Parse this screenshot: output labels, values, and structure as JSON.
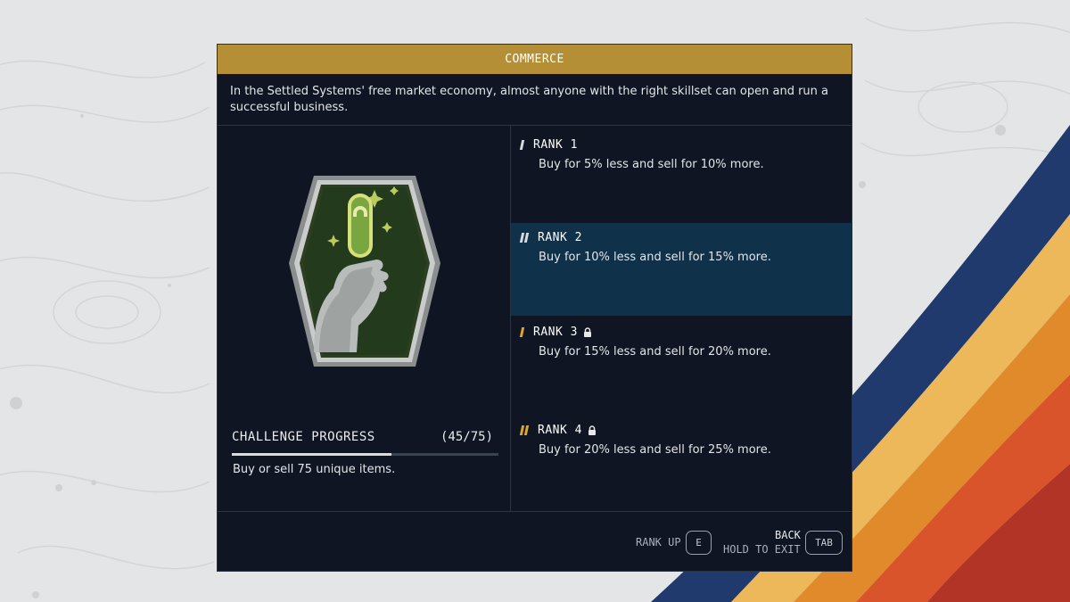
{
  "colors": {
    "accent": "#b58f36",
    "panel_bg": "#0f1522",
    "selected_row": "#0f3149",
    "rank_bar_gold": "#e0a626",
    "rank_bar_white": "#d8dadd"
  },
  "header": {
    "title": "COMMERCE"
  },
  "description": "In the Settled Systems' free market economy, almost anyone with the right skillset can open and run a successful business.",
  "emblem": {
    "icon": "hand-holding-credstick-icon"
  },
  "challenge": {
    "title": "CHALLENGE PROGRESS",
    "count": "(45/75)",
    "progress": 0.6,
    "description": "Buy or sell 75 unique items."
  },
  "ranks": [
    {
      "label": "RANK 1",
      "description": "Buy for 5% less and sell for 10% more.",
      "locked": false,
      "selected": false
    },
    {
      "label": "RANK 2",
      "description": "Buy for 10% less and sell for 15% more.",
      "locked": false,
      "selected": true
    },
    {
      "label": "RANK 3",
      "description": "Buy for 15% less and sell for 20% more.",
      "locked": true,
      "selected": false
    },
    {
      "label": "RANK 4",
      "description": "Buy for 20% less and sell for 25% more.",
      "locked": true,
      "selected": false
    }
  ],
  "footer": {
    "rank_up_label": "RANK UP",
    "rank_up_key": "E",
    "back_label": "BACK",
    "hold_exit_label": "HOLD TO EXIT",
    "back_key": "TAB"
  }
}
